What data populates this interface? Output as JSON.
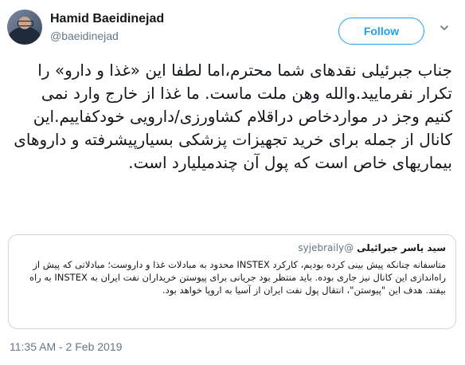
{
  "author": {
    "name": "Hamid Baeidinejad",
    "handle": "@baeidinejad"
  },
  "follow_button": {
    "label": "Follow"
  },
  "tweet": {
    "text": "جناب جبرئیلی نقدهای شما محترم،اما لطفا این «غذا و دارو» را تکرار نفرمایید.والله وهن ملت ماست. ما غذا از خارج وارد نمی کنیم وجز در مواردخاص دراقلام کشاورزی/دارویی خودکفاییم.این کانال از جمله برای خرید تجهیزات پزشکی بسیارپیشرفته و داروهای بیماریهای خاص است که پول آن چندمیلیارد است."
  },
  "quoted_tweet": {
    "name": "سید یاسر جبرائیلی",
    "handle": "@syjebraily",
    "text": "متاسفانه چنانکه پیش بینی کرده بودیم، کارکرد INSTEX محدود به مبادلات غذا و داروست؛ مبادلاتی که پیش از راه‌اندازی این کانال نیز جاری بوده. باید منتظر بود جریانی برای پیوستن خریداران نفت ایران به INSTEX به راه بیفتد. هدف این \"پیوستن\"، انتقال پول نفت ایران از آسیا به اروپا خواهد بود."
  },
  "timestamp": "11:35 AM - 2 Feb 2019",
  "icons": {
    "menu": "chevron-down-icon"
  },
  "colors": {
    "accent": "#1da1f2",
    "muted": "#657786",
    "border": "#ccd6dd"
  }
}
